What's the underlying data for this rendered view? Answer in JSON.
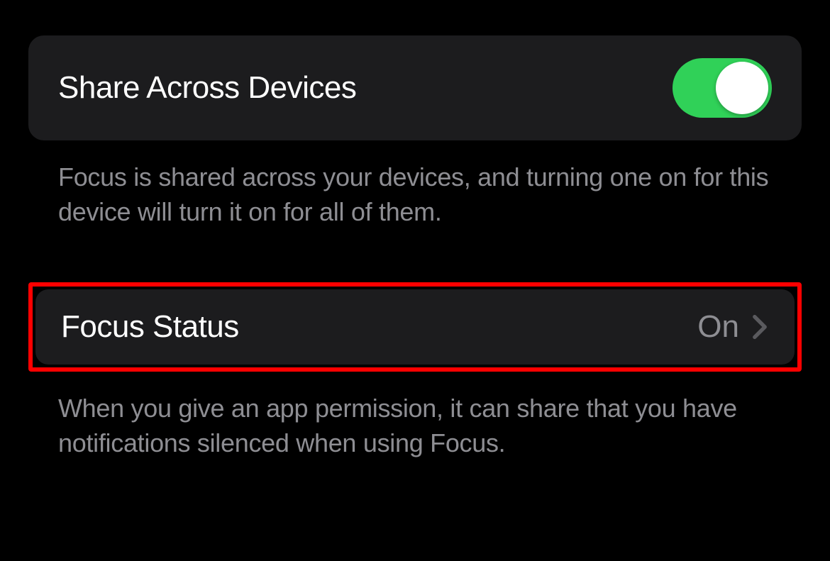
{
  "shareAcrossDevices": {
    "label": "Share Across Devices",
    "enabled": true,
    "footer": "Focus is shared across your devices, and turning one on for this device will turn it on for all of them."
  },
  "focusStatus": {
    "label": "Focus Status",
    "value": "On",
    "footer": "When you give an app permission, it can share that you have notifications silenced when using Focus."
  }
}
